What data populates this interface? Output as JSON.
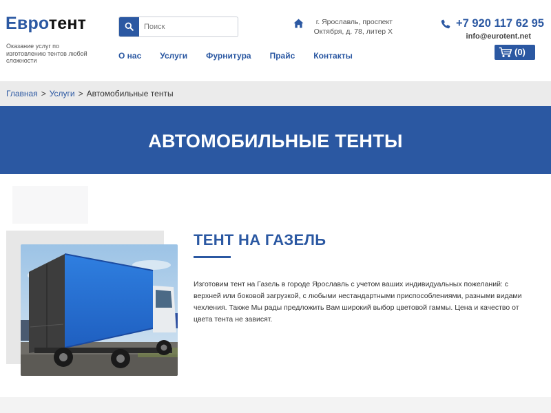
{
  "logo": {
    "part1": "Евро",
    "part2": "тент"
  },
  "tagline": "Оказание услуг по изготовлению тентов любой сложности",
  "search": {
    "placeholder": "Поиск",
    "value": ""
  },
  "nav": [
    {
      "label": "О нас"
    },
    {
      "label": "Услуги"
    },
    {
      "label": "Фурнитура"
    },
    {
      "label": "Прайс"
    },
    {
      "label": "Контакты"
    }
  ],
  "contacts": {
    "address": "г. Ярославль, проспект Октября, д. 78, литер Х",
    "phone": "+7 920 117 62 95",
    "email": "info@eurotent.net"
  },
  "cart": {
    "count": "(0)"
  },
  "breadcrumb": {
    "items": [
      "Главная",
      "Услуги",
      "Автомобильные тенты"
    ],
    "separator": ">"
  },
  "banner": {
    "title": "АВТОМОБИЛЬНЫЕ ТЕНТЫ"
  },
  "section": {
    "title": "ТЕНТ НА ГАЗЕЛЬ",
    "text": "Изготовим тент на Газель в городе Ярославль с учетом ваших индивидуальных пожеланий: с верхней или боковой загрузкой, с любыми нестандартными приспособлениями, разными видами чехления. Также Мы рады предложить Вам широкий выбор цветовой гаммы.  Цена и качество от цвета тента не зависят."
  },
  "icons": {
    "search": "search-icon",
    "address": "home-icon",
    "phone": "phone-icon",
    "cart": "cart-icon"
  },
  "colors": {
    "brand_blue": "#2b58a2",
    "breadcrumb_bg": "#ebebeb",
    "text": "#333333"
  }
}
